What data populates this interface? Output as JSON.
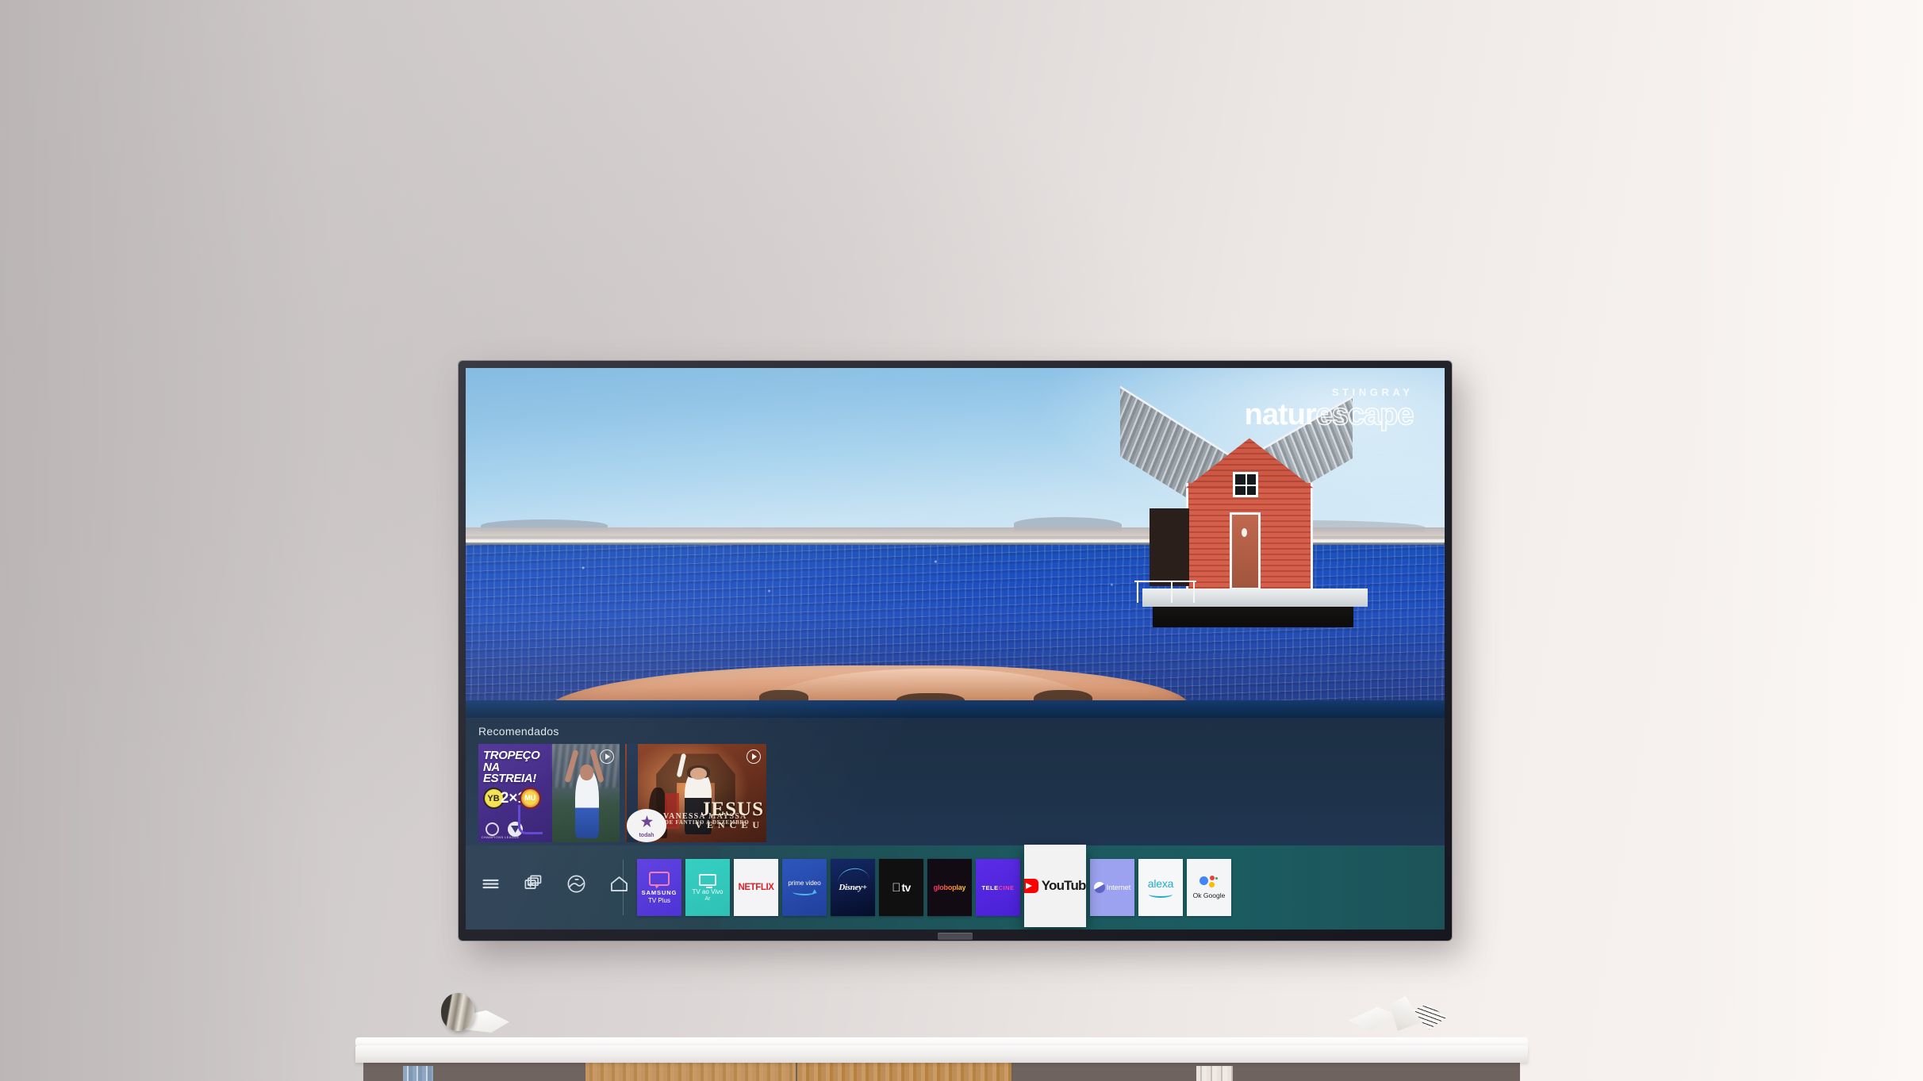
{
  "scene": {
    "brand_top": "STINGRAY",
    "brand_main_a": "natur",
    "brand_main_b": "escape",
    "description": "Red boathouse on a dock by blue sea"
  },
  "recommended": {
    "title": "Recomendados",
    "cards": [
      {
        "name": "football-highlight",
        "headline": "TROPEÇO NA ESTREIA!",
        "score": "2×1",
        "team_home": "YB",
        "team_away": "MU",
        "league": "CHAMPIONS LEAGUE",
        "play_label": "play"
      },
      {
        "name": "gospel-show",
        "title_main": "JESUS",
        "title_sub": "VENCEU",
        "artist": "VANESSA MAYSSA",
        "artist_sub": "DE FANTINO A DEZEMBRO",
        "badge": "todah",
        "play_label": "play"
      }
    ]
  },
  "appbar": {
    "system_icons": [
      {
        "name": "menu-icon",
        "label": "Menu"
      },
      {
        "name": "add-app-icon",
        "label": "Adicionar"
      },
      {
        "name": "ambient-icon",
        "label": "Ambiente"
      },
      {
        "name": "home-icon",
        "label": "Início"
      }
    ],
    "apps": [
      {
        "id": "samsung",
        "label": "SAMSUNG",
        "label2": "TV Plus",
        "selected": false
      },
      {
        "id": "tvaovivo",
        "label": "TV ao Vivo",
        "label2": "Ar",
        "selected": false
      },
      {
        "id": "netflix",
        "label": "NETFLIX",
        "selected": false
      },
      {
        "id": "prime",
        "label": "prime video",
        "selected": false
      },
      {
        "id": "disney",
        "label": "Disney+",
        "selected": false
      },
      {
        "id": "appletv",
        "label": "tv",
        "selected": false
      },
      {
        "id": "globo",
        "label": "globoplay",
        "selected": false
      },
      {
        "id": "telecine",
        "label": "TELE",
        "label2": "CINE",
        "selected": false
      },
      {
        "id": "youtube",
        "label": "YouTube",
        "selected": true
      },
      {
        "id": "internet",
        "label": "Internet",
        "selected": false
      },
      {
        "id": "alexa",
        "label": "alexa",
        "selected": false
      },
      {
        "id": "okgoogle",
        "label": "Ok Google",
        "selected": false
      }
    ]
  },
  "colors": {
    "wall_left": "#cbc6c6",
    "wall_right": "#f7f3f1",
    "bar_left": "#263a4f",
    "bar_right": "#1b5c61",
    "strip_bg": "#1d3147",
    "netflix_red": "#d81f26",
    "youtube_red": "#ff0000",
    "alexa_teal": "#23adc9"
  }
}
